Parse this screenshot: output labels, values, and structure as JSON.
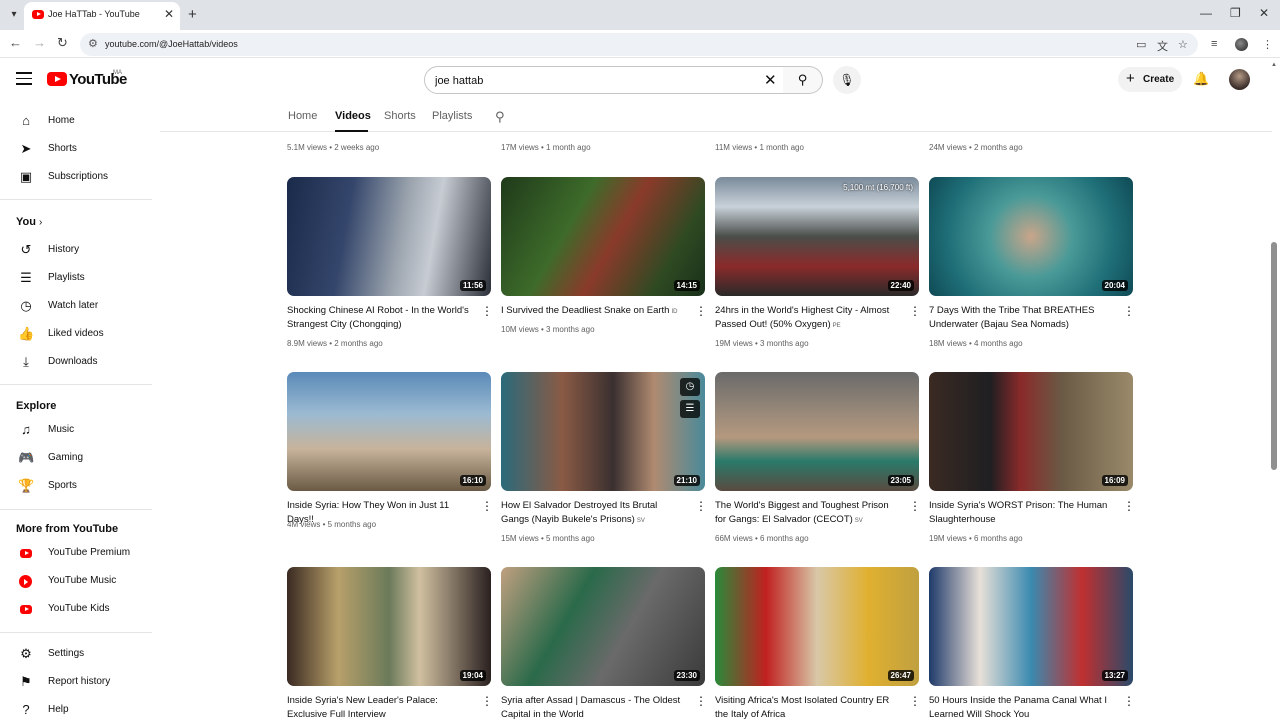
{
  "browser": {
    "tab_title": "Joe HaTTab - YouTube",
    "url": "youtube.com/@JoeHattab/videos"
  },
  "masthead": {
    "logo_text": "YouTube",
    "country": "MA",
    "search_value": "joe hattab",
    "create_label": "Create"
  },
  "sidebar": {
    "main": [
      {
        "label": "Home",
        "icon": "home-icon"
      },
      {
        "label": "Shorts",
        "icon": "shorts-icon"
      },
      {
        "label": "Subscriptions",
        "icon": "subscriptions-icon"
      }
    ],
    "you_heading": "You",
    "you": [
      {
        "label": "History",
        "icon": "history-icon"
      },
      {
        "label": "Playlists",
        "icon": "playlists-icon"
      },
      {
        "label": "Watch later",
        "icon": "watch-later-icon"
      },
      {
        "label": "Liked videos",
        "icon": "liked-icon"
      },
      {
        "label": "Downloads",
        "icon": "download-icon"
      }
    ],
    "explore_heading": "Explore",
    "explore": [
      {
        "label": "Music",
        "icon": "music-icon"
      },
      {
        "label": "Gaming",
        "icon": "gaming-icon"
      },
      {
        "label": "Sports",
        "icon": "trophy-icon"
      }
    ],
    "more_heading": "More from YouTube",
    "more": [
      {
        "label": "YouTube Premium",
        "icon": "youtube-premium-icon"
      },
      {
        "label": "YouTube Music",
        "icon": "youtube-music-icon"
      },
      {
        "label": "YouTube Kids",
        "icon": "youtube-kids-icon"
      }
    ],
    "bottom": [
      {
        "label": "Settings",
        "icon": "settings-icon"
      },
      {
        "label": "Report history",
        "icon": "flag-icon"
      },
      {
        "label": "Help",
        "icon": "help-icon"
      }
    ]
  },
  "channel_tabs": [
    "Home",
    "Videos",
    "Shorts",
    "Playlists"
  ],
  "active_tab": "Videos",
  "previous_row": [
    "5.1M views • 2 weeks ago",
    "17M views • 1 month ago",
    "11M views • 1 month ago",
    "24M views • 2 months ago"
  ],
  "videos": [
    {
      "title": "Shocking Chinese AI Robot - In the World's Strangest City (Chongqing)",
      "badge": "",
      "meta": "8.9M views • 2 months ago",
      "duration": "11:56"
    },
    {
      "title": "I Survived the Deadliest Snake on Earth",
      "badge": "ID",
      "meta": "10M views • 3 months ago",
      "duration": "14:15"
    },
    {
      "title": "24hrs in the World's Highest City - Almost Passed Out! (50% Oxygen)",
      "badge": "PE",
      "meta": "19M views • 3 months ago",
      "duration": "22:40"
    },
    {
      "title": "7 Days With the Tribe That BREATHES Underwater (Bajau Sea Nomads)",
      "badge": "",
      "meta": "18M views • 4 months ago",
      "duration": "20:04"
    },
    {
      "title": "Inside Syria: How They Won in Just 11 Days!!",
      "badge": "",
      "meta": "4M views • 5 months ago",
      "duration": "16:10"
    },
    {
      "title": "How El Salvador Destroyed Its Brutal Gangs (Nayib Bukele's Prisons)",
      "badge": "SV",
      "meta": "15M views • 5 months ago",
      "duration": "21:10"
    },
    {
      "title": "The World's Biggest and Toughest Prison for Gangs: El Salvador (CECOT)",
      "badge": "SV",
      "meta": "66M views • 6 months ago",
      "duration": "23:05"
    },
    {
      "title": "Inside Syria's WORST Prison: The Human Slaughterhouse",
      "badge": "",
      "meta": "19M views • 6 months ago",
      "duration": "16:09"
    },
    {
      "title": "Inside Syria's New Leader's Palace: Exclusive Full Interview",
      "badge": "",
      "meta": "",
      "duration": "19:04"
    },
    {
      "title": "Syria after Assad | Damascus - The Oldest Capital in the World",
      "badge": "",
      "meta": "",
      "duration": "23:30"
    },
    {
      "title": "Visiting Africa's Most Isolated Country ER the Italy of Africa",
      "badge": "",
      "meta": "",
      "duration": "26:47"
    },
    {
      "title": "50 Hours Inside the Panama Canal What I Learned Will Shock You",
      "badge": "",
      "meta": "",
      "duration": "13:27"
    }
  ],
  "thumb_overlay_text": "5,100 mt (16,700 ft)",
  "colors": {
    "accent": "#ff0000",
    "text": "#0f0f0f",
    "secondary": "#606060"
  }
}
